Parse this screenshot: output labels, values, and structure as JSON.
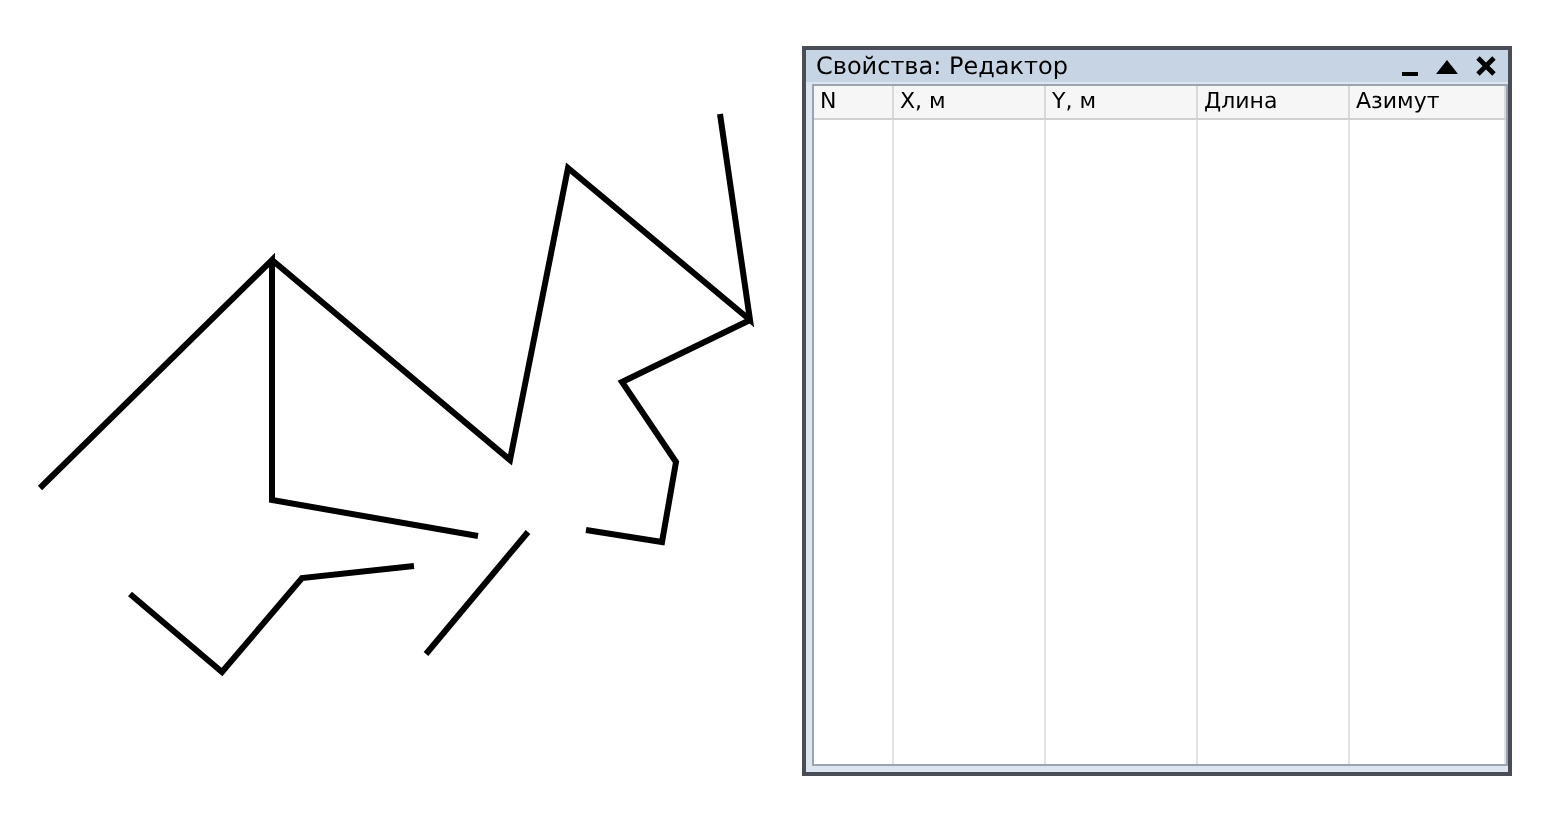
{
  "panel": {
    "title": "Свойства: Редактор"
  },
  "table": {
    "columns": [
      "N",
      "X, м",
      "Y, м",
      "Длина",
      "Азимут"
    ]
  }
}
